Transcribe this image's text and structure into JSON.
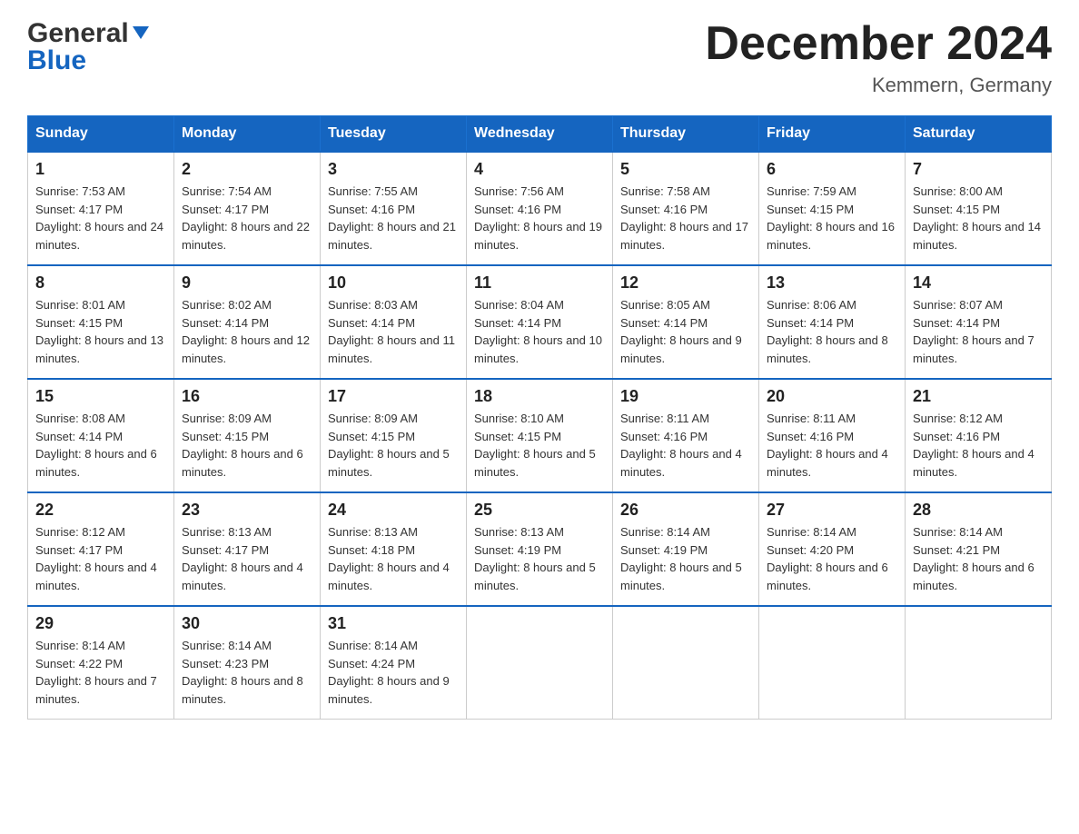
{
  "header": {
    "logo_line1": "General",
    "logo_line2": "Blue",
    "month_title": "December 2024",
    "location": "Kemmern, Germany"
  },
  "weekdays": [
    "Sunday",
    "Monday",
    "Tuesday",
    "Wednesday",
    "Thursday",
    "Friday",
    "Saturday"
  ],
  "weeks": [
    [
      {
        "day": "1",
        "sunrise": "7:53 AM",
        "sunset": "4:17 PM",
        "daylight": "8 hours and 24 minutes."
      },
      {
        "day": "2",
        "sunrise": "7:54 AM",
        "sunset": "4:17 PM",
        "daylight": "8 hours and 22 minutes."
      },
      {
        "day": "3",
        "sunrise": "7:55 AM",
        "sunset": "4:16 PM",
        "daylight": "8 hours and 21 minutes."
      },
      {
        "day": "4",
        "sunrise": "7:56 AM",
        "sunset": "4:16 PM",
        "daylight": "8 hours and 19 minutes."
      },
      {
        "day": "5",
        "sunrise": "7:58 AM",
        "sunset": "4:16 PM",
        "daylight": "8 hours and 17 minutes."
      },
      {
        "day": "6",
        "sunrise": "7:59 AM",
        "sunset": "4:15 PM",
        "daylight": "8 hours and 16 minutes."
      },
      {
        "day": "7",
        "sunrise": "8:00 AM",
        "sunset": "4:15 PM",
        "daylight": "8 hours and 14 minutes."
      }
    ],
    [
      {
        "day": "8",
        "sunrise": "8:01 AM",
        "sunset": "4:15 PM",
        "daylight": "8 hours and 13 minutes."
      },
      {
        "day": "9",
        "sunrise": "8:02 AM",
        "sunset": "4:14 PM",
        "daylight": "8 hours and 12 minutes."
      },
      {
        "day": "10",
        "sunrise": "8:03 AM",
        "sunset": "4:14 PM",
        "daylight": "8 hours and 11 minutes."
      },
      {
        "day": "11",
        "sunrise": "8:04 AM",
        "sunset": "4:14 PM",
        "daylight": "8 hours and 10 minutes."
      },
      {
        "day": "12",
        "sunrise": "8:05 AM",
        "sunset": "4:14 PM",
        "daylight": "8 hours and 9 minutes."
      },
      {
        "day": "13",
        "sunrise": "8:06 AM",
        "sunset": "4:14 PM",
        "daylight": "8 hours and 8 minutes."
      },
      {
        "day": "14",
        "sunrise": "8:07 AM",
        "sunset": "4:14 PM",
        "daylight": "8 hours and 7 minutes."
      }
    ],
    [
      {
        "day": "15",
        "sunrise": "8:08 AM",
        "sunset": "4:14 PM",
        "daylight": "8 hours and 6 minutes."
      },
      {
        "day": "16",
        "sunrise": "8:09 AM",
        "sunset": "4:15 PM",
        "daylight": "8 hours and 6 minutes."
      },
      {
        "day": "17",
        "sunrise": "8:09 AM",
        "sunset": "4:15 PM",
        "daylight": "8 hours and 5 minutes."
      },
      {
        "day": "18",
        "sunrise": "8:10 AM",
        "sunset": "4:15 PM",
        "daylight": "8 hours and 5 minutes."
      },
      {
        "day": "19",
        "sunrise": "8:11 AM",
        "sunset": "4:16 PM",
        "daylight": "8 hours and 4 minutes."
      },
      {
        "day": "20",
        "sunrise": "8:11 AM",
        "sunset": "4:16 PM",
        "daylight": "8 hours and 4 minutes."
      },
      {
        "day": "21",
        "sunrise": "8:12 AM",
        "sunset": "4:16 PM",
        "daylight": "8 hours and 4 minutes."
      }
    ],
    [
      {
        "day": "22",
        "sunrise": "8:12 AM",
        "sunset": "4:17 PM",
        "daylight": "8 hours and 4 minutes."
      },
      {
        "day": "23",
        "sunrise": "8:13 AM",
        "sunset": "4:17 PM",
        "daylight": "8 hours and 4 minutes."
      },
      {
        "day": "24",
        "sunrise": "8:13 AM",
        "sunset": "4:18 PM",
        "daylight": "8 hours and 4 minutes."
      },
      {
        "day": "25",
        "sunrise": "8:13 AM",
        "sunset": "4:19 PM",
        "daylight": "8 hours and 5 minutes."
      },
      {
        "day": "26",
        "sunrise": "8:14 AM",
        "sunset": "4:19 PM",
        "daylight": "8 hours and 5 minutes."
      },
      {
        "day": "27",
        "sunrise": "8:14 AM",
        "sunset": "4:20 PM",
        "daylight": "8 hours and 6 minutes."
      },
      {
        "day": "28",
        "sunrise": "8:14 AM",
        "sunset": "4:21 PM",
        "daylight": "8 hours and 6 minutes."
      }
    ],
    [
      {
        "day": "29",
        "sunrise": "8:14 AM",
        "sunset": "4:22 PM",
        "daylight": "8 hours and 7 minutes."
      },
      {
        "day": "30",
        "sunrise": "8:14 AM",
        "sunset": "4:23 PM",
        "daylight": "8 hours and 8 minutes."
      },
      {
        "day": "31",
        "sunrise": "8:14 AM",
        "sunset": "4:24 PM",
        "daylight": "8 hours and 9 minutes."
      },
      null,
      null,
      null,
      null
    ]
  ]
}
